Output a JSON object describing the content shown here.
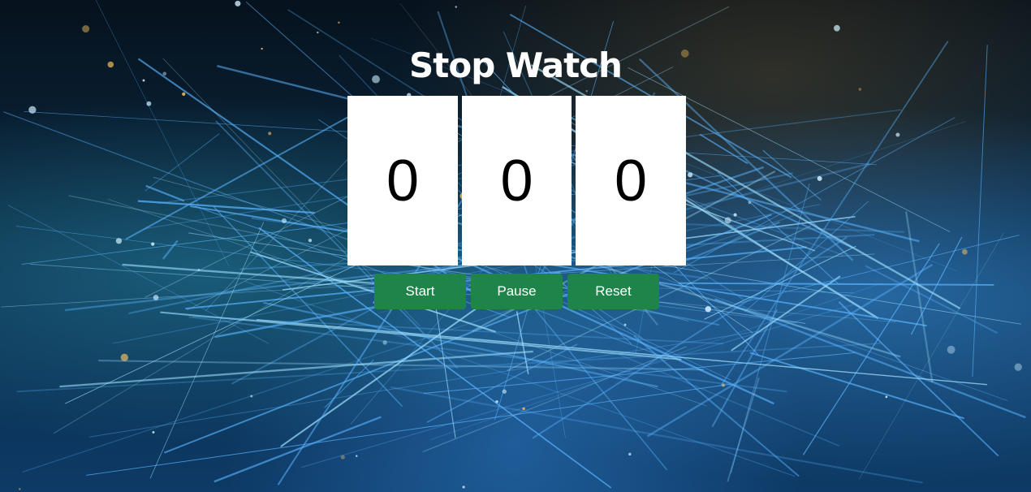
{
  "title": "Stop Watch",
  "display": {
    "minutes": "0",
    "seconds": "0",
    "milliseconds": "0"
  },
  "buttons": {
    "start": "Start",
    "pause": "Pause",
    "reset": "Reset"
  },
  "colors": {
    "button": "#1e8449",
    "box": "#ffffff"
  }
}
